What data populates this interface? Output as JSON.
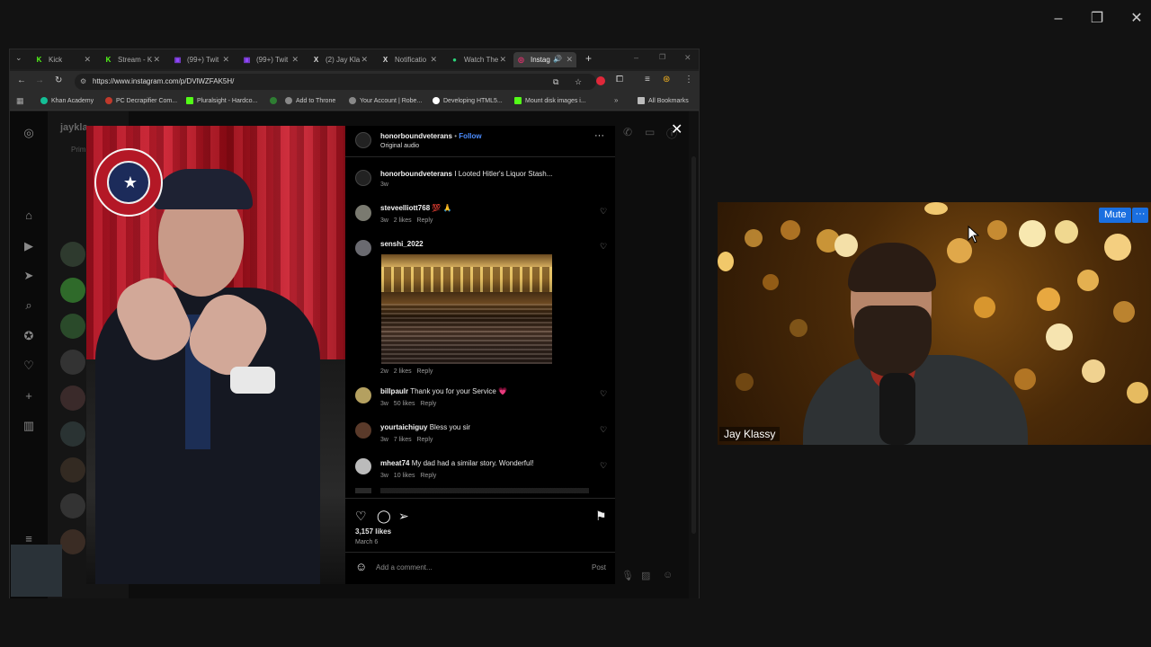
{
  "outer_window": {
    "minimize": "–",
    "restore": "❐",
    "close": "✕"
  },
  "tabs": [
    {
      "label": "Kick",
      "icon": "K",
      "color": "#53fc18"
    },
    {
      "label": "Stream - K",
      "icon": "K",
      "color": "#53fc18"
    },
    {
      "label": "(99+) Twit",
      "icon": "▣",
      "color": "#9146ff"
    },
    {
      "label": "(99+) Twit",
      "icon": "▣",
      "color": "#9146ff"
    },
    {
      "label": "(2) Jay Kla",
      "icon": "X",
      "color": "#dddddd"
    },
    {
      "label": "Notificatio",
      "icon": "X",
      "color": "#dddddd"
    },
    {
      "label": "Watch The",
      "icon": "●",
      "color": "#2bd67b"
    },
    {
      "label": "Instag",
      "icon": "◎",
      "color": "#e1306c"
    }
  ],
  "address": {
    "url": "https://www.instagram.com/p/DVlWZFAK5H/"
  },
  "bookmarks": [
    {
      "label": "Khan Academy",
      "color": "#14bf96"
    },
    {
      "label": "PC Decrapifier Com...",
      "color": "#c0392b"
    },
    {
      "label": "Pluralsight - Hardco...",
      "color": "#53fc18"
    },
    {
      "label": "",
      "color": "#2e7d32"
    },
    {
      "label": "Add to Throne",
      "color": "#888888"
    },
    {
      "label": "Your Account | Robe...",
      "color": "#888888"
    },
    {
      "label": "Developing HTML5...",
      "color": "#ffffff"
    },
    {
      "label": "Mount disk images i...",
      "color": "#53fc18"
    }
  ],
  "bookmarks_all": "All Bookmarks",
  "post": {
    "author": "honorboundveterans",
    "follow": "Follow",
    "bullet": "•",
    "audio": "Original audio",
    "caption_user": "honorboundveterans",
    "caption_text": "I Looted Hitler's Liquor Stash...",
    "caption_age": "3w",
    "likes": "3,157 likes",
    "date": "March 6",
    "comment_placeholder": "Add a comment...",
    "post_button": "Post",
    "background_username": "jaykla",
    "background_tab": "Prim"
  },
  "comments": [
    {
      "user": "steveelliott768",
      "text": "💯 🙏",
      "age": "3w",
      "likes": "2 likes",
      "reply": "Reply"
    },
    {
      "user": "senshi_2022",
      "text": "",
      "age": "2w",
      "likes": "2 likes",
      "reply": "Reply"
    },
    {
      "user": "billpaulr",
      "text": "Thank you for your Service 💗",
      "age": "3w",
      "likes": "50 likes",
      "reply": "Reply"
    },
    {
      "user": "yourtaichiguy",
      "text": "Bless you sir",
      "age": "3w",
      "likes": "7 likes",
      "reply": "Reply"
    },
    {
      "user": "mheat74",
      "text": "My dad had a similar story. Wonderful!",
      "age": "3w",
      "likes": "10 likes",
      "reply": "Reply"
    }
  ],
  "webcam": {
    "name": "Jay Klassy",
    "mute": "Mute",
    "more": "···"
  },
  "colors": {
    "accent_blue": "#1a6fe0",
    "ig_follow": "#4c8dff",
    "kick_green": "#53fc18"
  }
}
